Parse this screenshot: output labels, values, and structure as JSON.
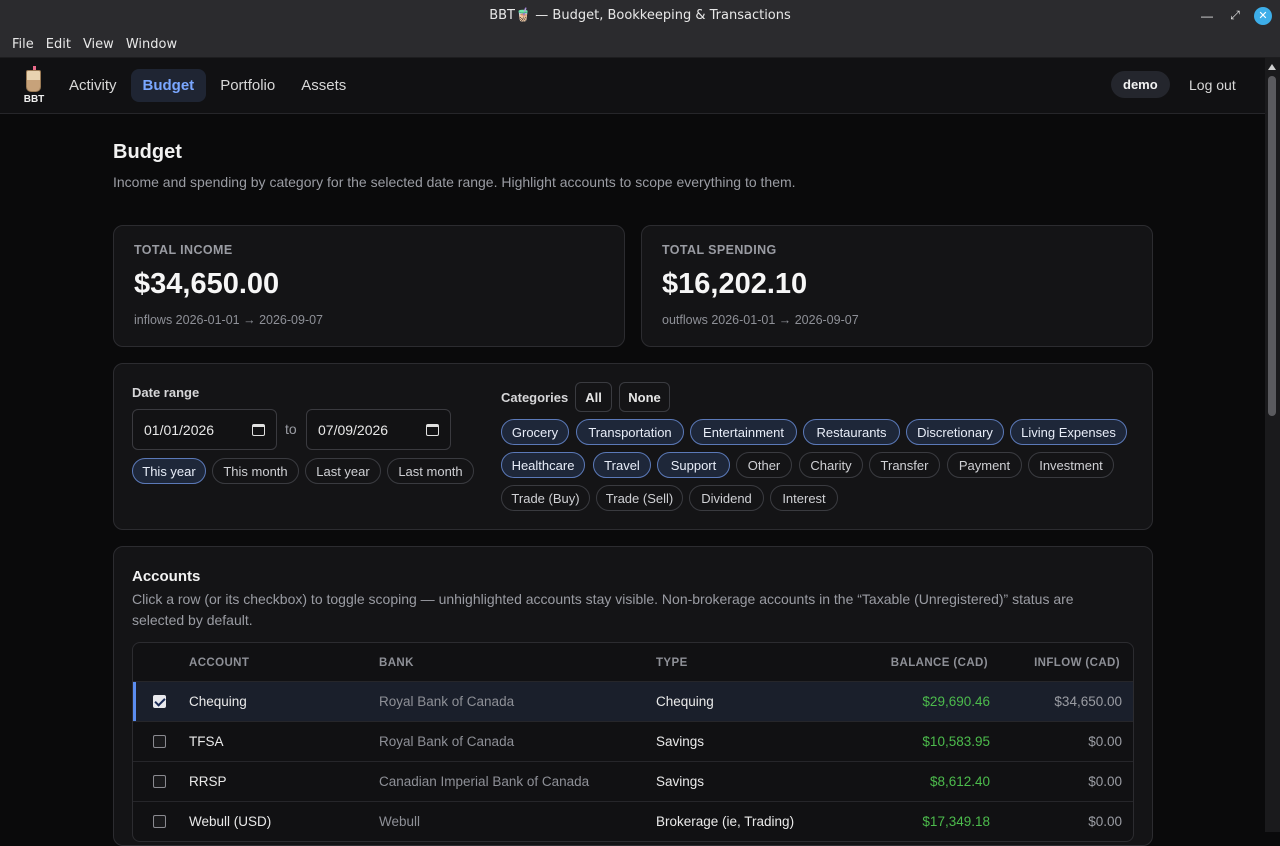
{
  "window": {
    "title": "BBT🧋 — Budget, Bookkeeping & Transactions"
  },
  "menubar": [
    "File",
    "Edit",
    "View",
    "Window"
  ],
  "nav": {
    "logo_text": "BBT",
    "links": [
      "Activity",
      "Budget",
      "Portfolio",
      "Assets"
    ],
    "active": "Budget",
    "user": "demo",
    "logout": "Log out"
  },
  "page": {
    "title": "Budget",
    "subtitle": "Income and spending by category for the selected date range. Highlight accounts to scope everything to them."
  },
  "income": {
    "label": "TOTAL INCOME",
    "value": "$34,650.00",
    "note": "inflows 2026-01-01 → 2026-09-07"
  },
  "spending": {
    "label": "TOTAL SPENDING",
    "value": "$16,202.10",
    "note": "outflows 2026-01-01 → 2026-09-07"
  },
  "filters": {
    "date_label": "Date range",
    "start": "01/01/2026",
    "to": "to",
    "end": "07/09/2026",
    "presets": [
      "This year",
      "This month",
      "Last year",
      "Last month"
    ],
    "active_preset": "This year",
    "categories_label": "Categories",
    "all_label": "All",
    "none_label": "None",
    "categories": [
      {
        "name": "Grocery",
        "on": true
      },
      {
        "name": "Transportation",
        "on": true
      },
      {
        "name": "Entertainment",
        "on": true
      },
      {
        "name": "Restaurants",
        "on": true
      },
      {
        "name": "Discretionary",
        "on": true
      },
      {
        "name": "Living Expenses",
        "on": true
      },
      {
        "name": "Healthcare",
        "on": true
      },
      {
        "name": "Travel",
        "on": true
      },
      {
        "name": "Support",
        "on": true
      },
      {
        "name": "Other",
        "on": false
      },
      {
        "name": "Charity",
        "on": false
      },
      {
        "name": "Transfer",
        "on": false
      },
      {
        "name": "Payment",
        "on": false
      },
      {
        "name": "Investment",
        "on": false
      },
      {
        "name": "Trade (Buy)",
        "on": false
      },
      {
        "name": "Trade (Sell)",
        "on": false
      },
      {
        "name": "Dividend",
        "on": false
      },
      {
        "name": "Interest",
        "on": false
      }
    ]
  },
  "accounts": {
    "title": "Accounts",
    "description": "Click a row (or its checkbox) to toggle scoping — unhighlighted accounts stay visible. Non-brokerage accounts in the “Taxable (Unregistered)” status are selected by default.",
    "columns": [
      "ACCOUNT",
      "BANK",
      "TYPE",
      "BALANCE (CAD)",
      "INFLOW (CAD)"
    ],
    "rows": [
      {
        "account": "Chequing",
        "bank": "Royal Bank of Canada",
        "type": "Chequing",
        "balance": "$29,690.46",
        "inflow": "$34,650.00",
        "selected": true
      },
      {
        "account": "TFSA",
        "bank": "Royal Bank of Canada",
        "type": "Savings",
        "balance": "$10,583.95",
        "inflow": "$0.00",
        "selected": false
      },
      {
        "account": "RRSP",
        "bank": "Canadian Imperial Bank of Canada",
        "type": "Savings",
        "balance": "$8,612.40",
        "inflow": "$0.00",
        "selected": false
      },
      {
        "account": "Webull (USD)",
        "bank": "Webull",
        "type": "Brokerage (ie, Trading)",
        "balance": "$17,349.18",
        "inflow": "$0.00",
        "selected": false
      }
    ]
  }
}
